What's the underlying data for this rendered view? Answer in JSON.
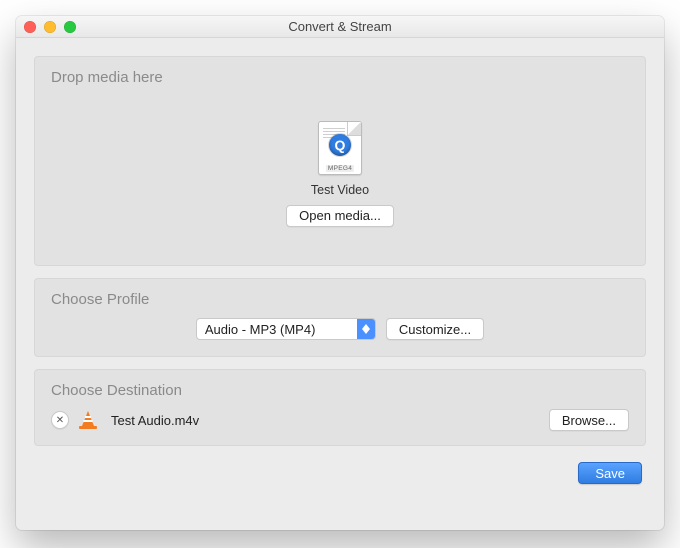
{
  "window": {
    "title": "Convert & Stream"
  },
  "drop": {
    "title": "Drop media here",
    "file_label": "Test Video",
    "file_badge": "MPEG4",
    "open_button": "Open media..."
  },
  "profile": {
    "title": "Choose Profile",
    "selected": "Audio - MP3 (MP4)",
    "customize_button": "Customize..."
  },
  "destination": {
    "title": "Choose Destination",
    "filename": "Test Audio.m4v",
    "browse_button": "Browse..."
  },
  "footer": {
    "save_button": "Save"
  },
  "icons": {
    "close": "close-icon",
    "minimize": "minimize-icon",
    "maximize": "maximize-icon",
    "quicktime": "quicktime-file-icon",
    "vlc": "vlc-cone-icon",
    "remove": "remove-icon",
    "dropdown": "dropdown-arrows-icon"
  }
}
